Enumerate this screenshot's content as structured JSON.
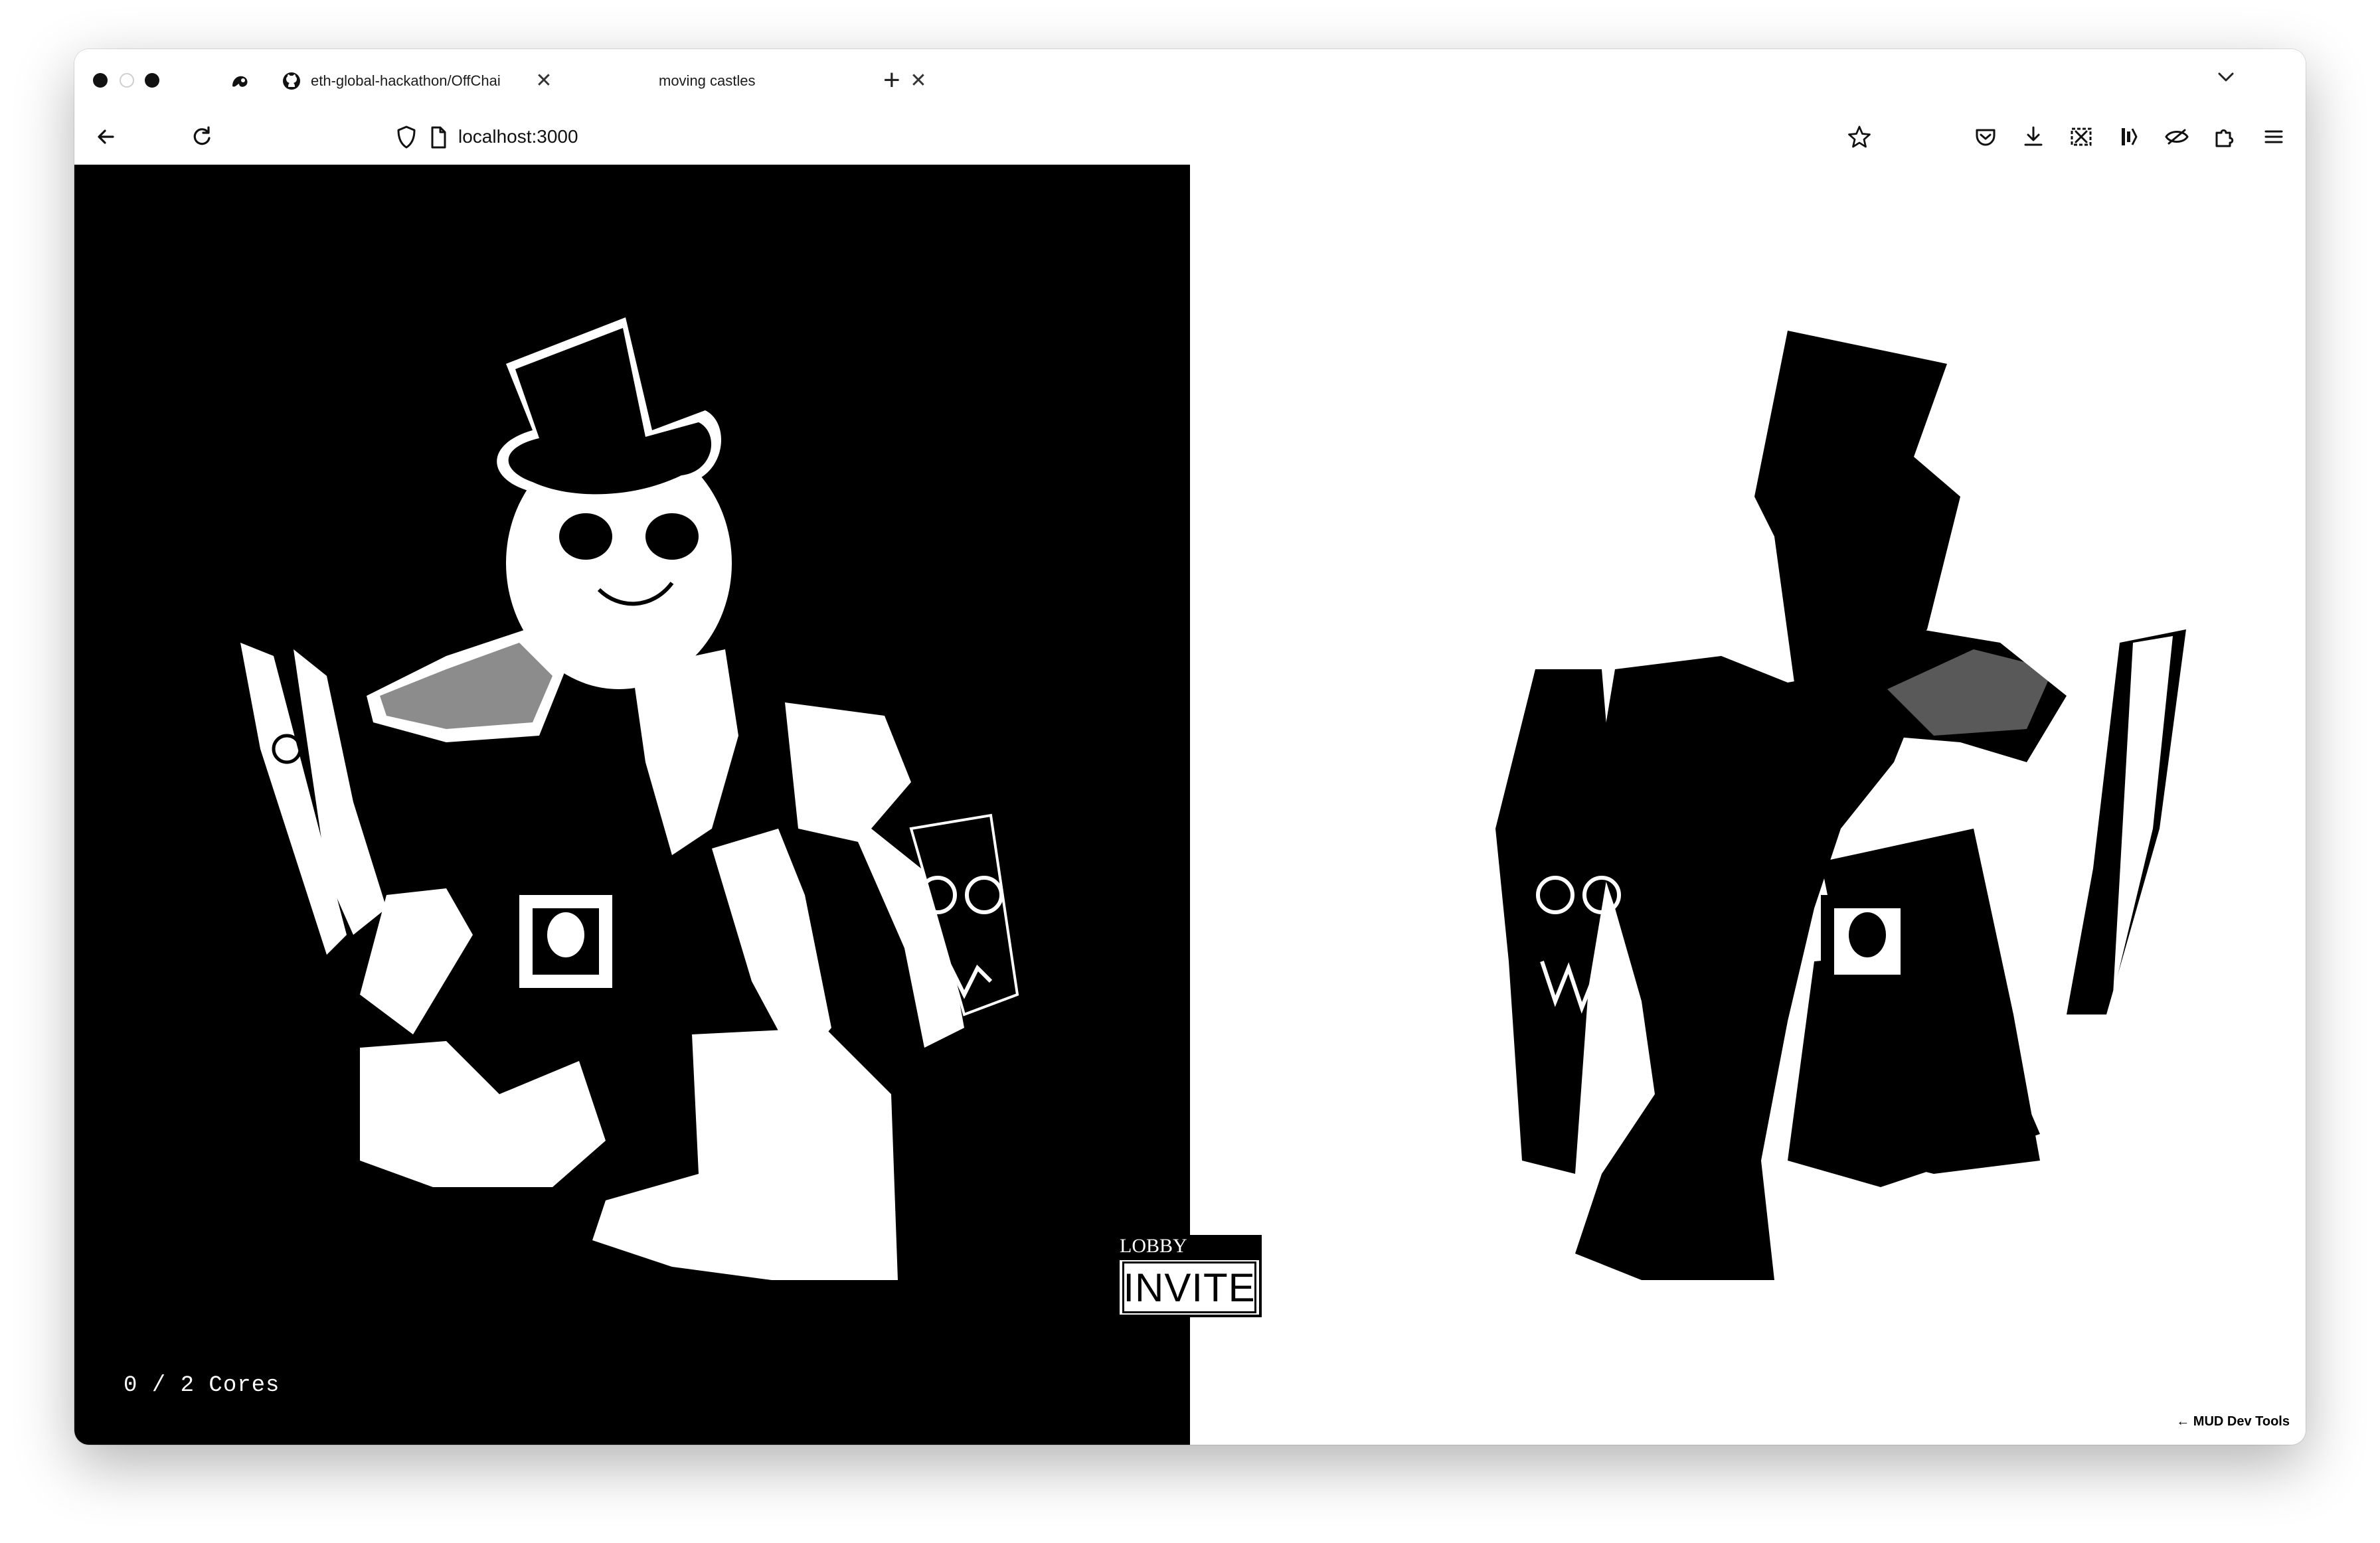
{
  "window": {
    "tabs": [
      {
        "label": "eth-global-hackathon/OffChai",
        "icon": "github-icon"
      },
      {
        "label": "moving castles",
        "icon": "none"
      }
    ],
    "new_tab_label": "+",
    "close_label": "✕"
  },
  "toolbar": {
    "url": "localhost:3000"
  },
  "page": {
    "left_theme": "#000000",
    "right_theme": "#ffffff",
    "cores_text": "0 / 2 Cores",
    "lobby_label": "LOBBY",
    "invite_label": "INVITE",
    "devtools_label": "← MUD Dev Tools"
  }
}
